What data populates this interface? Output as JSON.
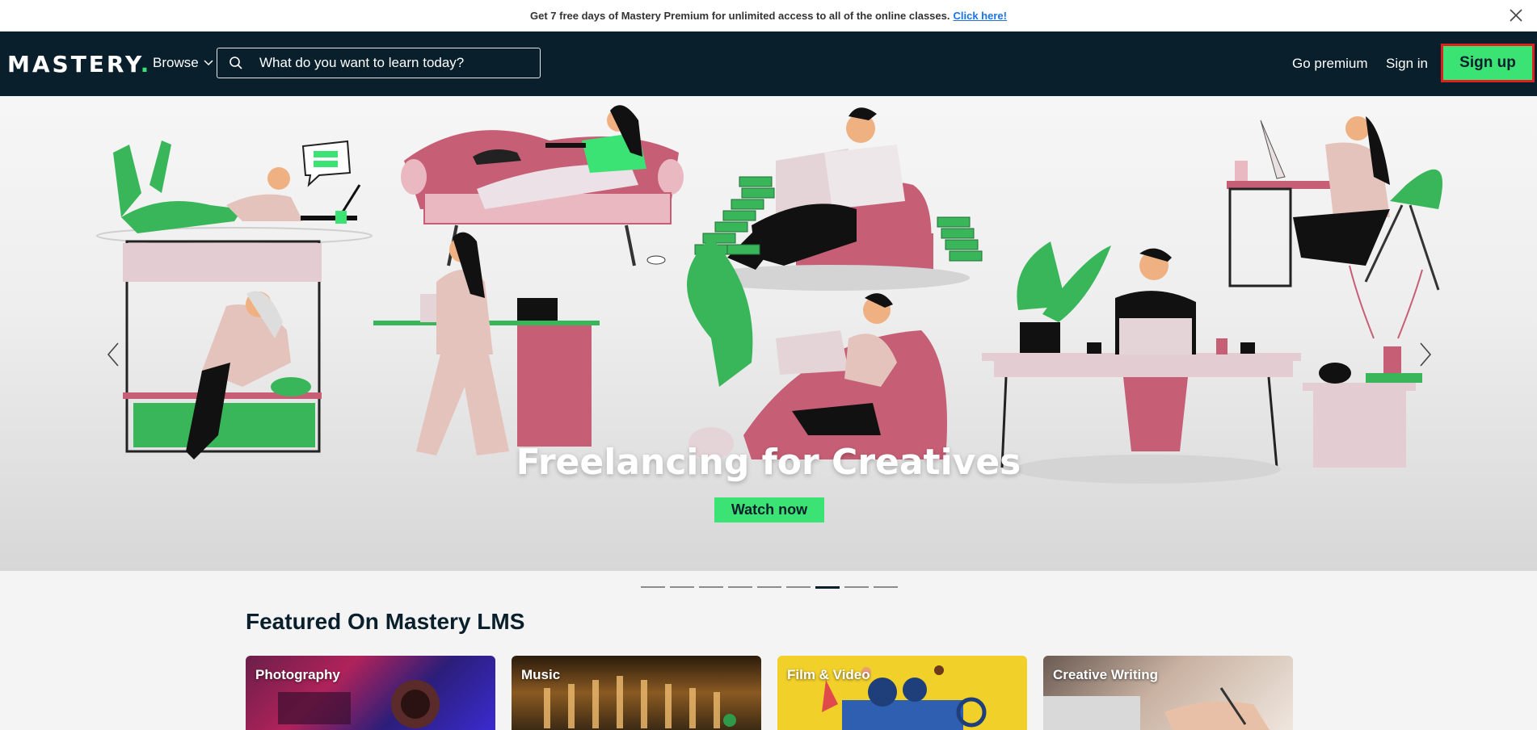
{
  "promo": {
    "text": "Get 7 free days of Mastery Premium for unlimited access to all of the online classes.",
    "link": "Click here!"
  },
  "nav": {
    "logo": "MASTERY",
    "logo_dot": ".",
    "browse": "Browse",
    "search_placeholder": "What do you want to learn today?",
    "go_premium": "Go premium",
    "sign_in": "Sign in",
    "sign_up": "Sign up"
  },
  "hero": {
    "title": "Freelancing for Creatives",
    "cta": "Watch now",
    "slide_count": 9,
    "active_slide": 7
  },
  "featured": {
    "title": "Featured On Mastery LMS",
    "cards": [
      {
        "label": "Photography"
      },
      {
        "label": "Music"
      },
      {
        "label": "Film & Video"
      },
      {
        "label": "Creative Writing"
      }
    ]
  },
  "colors": {
    "brand_green": "#3ae374",
    "nav_bg": "#0a1f2c",
    "highlight_border": "#e02020"
  }
}
